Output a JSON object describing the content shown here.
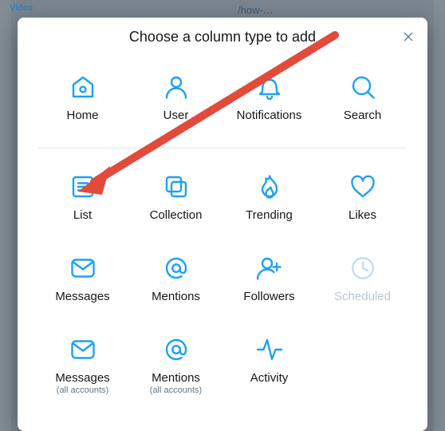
{
  "bg": {
    "video_label": "Video",
    "how_text": "/how-…"
  },
  "modal": {
    "title": "Choose a column type to add",
    "close": "×"
  },
  "tiles_top": [
    {
      "key": "home",
      "label": "Home"
    },
    {
      "key": "user",
      "label": "User"
    },
    {
      "key": "notifications",
      "label": "Notifications"
    },
    {
      "key": "search",
      "label": "Search"
    }
  ],
  "tiles_bottom": [
    {
      "key": "list",
      "label": "List"
    },
    {
      "key": "collection",
      "label": "Collection"
    },
    {
      "key": "trending",
      "label": "Trending"
    },
    {
      "key": "likes",
      "label": "Likes"
    },
    {
      "key": "messages",
      "label": "Messages"
    },
    {
      "key": "mentions",
      "label": "Mentions"
    },
    {
      "key": "followers",
      "label": "Followers"
    },
    {
      "key": "scheduled",
      "label": "Scheduled",
      "disabled": true
    },
    {
      "key": "messages_all",
      "label": "Messages",
      "subtitle": "(all accounts)"
    },
    {
      "key": "mentions_all",
      "label": "Mentions",
      "subtitle": "(all accounts)"
    },
    {
      "key": "activity",
      "label": "Activity"
    }
  ],
  "colors": {
    "accent": "#1da1f2",
    "arrow": "#e24a3b"
  }
}
